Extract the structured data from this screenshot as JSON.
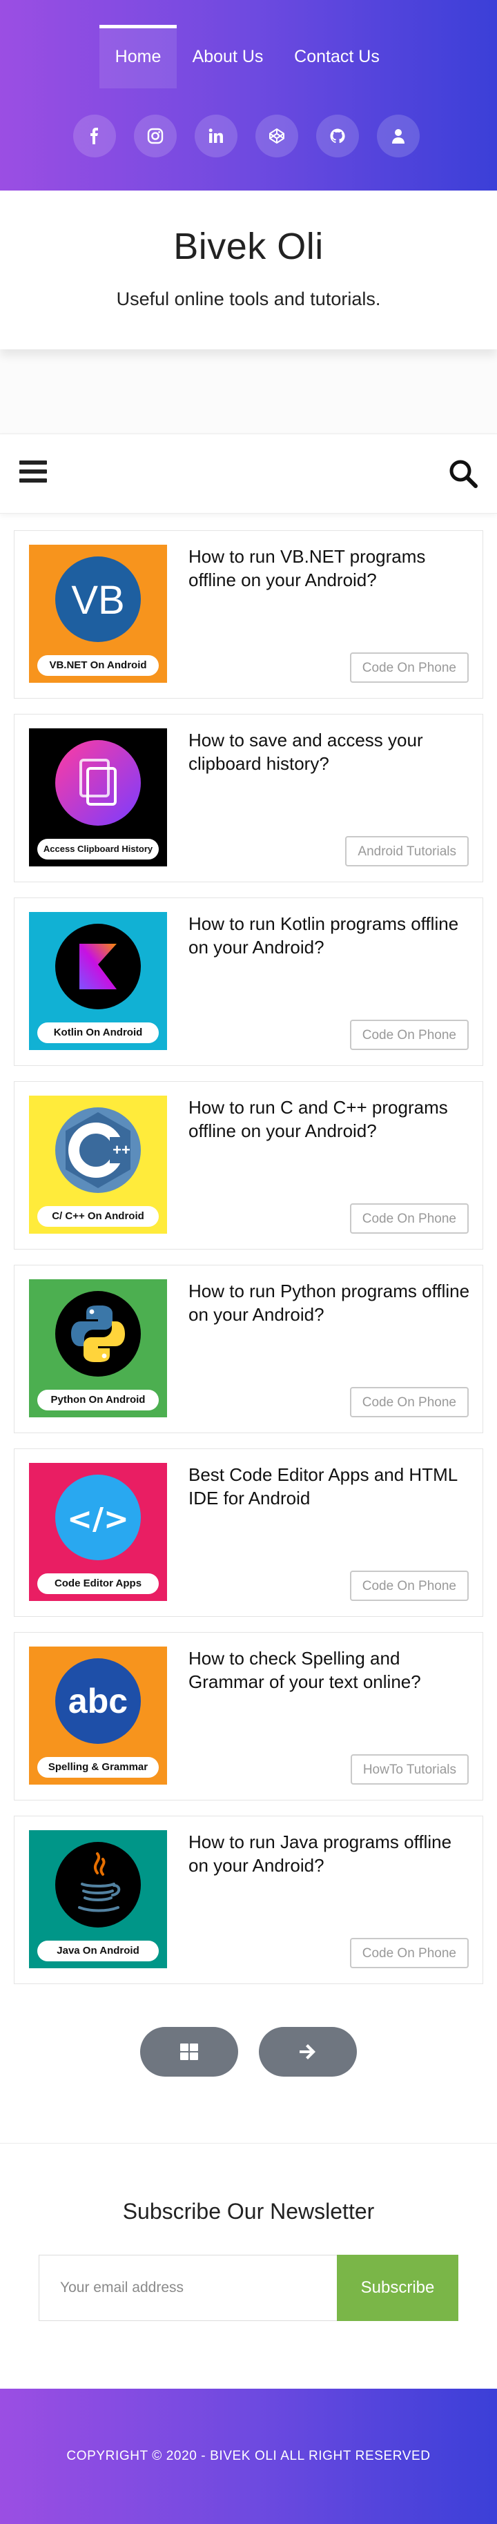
{
  "nav": {
    "items": [
      {
        "label": "Home",
        "active": true
      },
      {
        "label": "About Us",
        "active": false
      },
      {
        "label": "Contact Us",
        "active": false
      }
    ]
  },
  "social_icons": [
    "facebook-icon",
    "instagram-icon",
    "linkedin-icon",
    "codepen-icon",
    "github-icon",
    "user-icon"
  ],
  "site": {
    "title": "Bivek Oli",
    "description": "Useful online tools and tutorials."
  },
  "posts": [
    {
      "title": "How to run VB.NET programs offline on your Android?",
      "thumb_label": "VB.NET On Android",
      "thumb_text": "VB",
      "category": "Code On Phone",
      "thumb_bg": "#f7941d",
      "icon": "vbnet-logo-icon"
    },
    {
      "title": "How to save and access your clipboard history?",
      "thumb_label": "Access Clipboard History",
      "category": "Android Tutorials",
      "thumb_bg": "#000000",
      "icon": "clipboard-icon"
    },
    {
      "title": "How to run Kotlin programs offline on your Android?",
      "thumb_label": "Kotlin On Android",
      "category": "Code On Phone",
      "thumb_bg": "#11b1d4",
      "icon": "kotlin-logo-icon"
    },
    {
      "title": "How to run C and C++ programs offline on your Android?",
      "thumb_label": "C/ C++ On Android",
      "thumb_text": "C",
      "category": "Code On Phone",
      "thumb_bg": "#ffeb3b",
      "icon": "cpp-logo-icon"
    },
    {
      "title": "How to run Python programs offline on your Android?",
      "thumb_label": "Python On Android",
      "category": "Code On Phone",
      "thumb_bg": "#4caf50",
      "icon": "python-logo-icon"
    },
    {
      "title": "Best Code Editor Apps and HTML IDE for Android",
      "thumb_label": "Code Editor Apps",
      "thumb_text": "</>",
      "category": "Code On Phone",
      "thumb_bg": "#e91e63",
      "icon": "code-brackets-icon"
    },
    {
      "title": "How to check Spelling and Grammar of your text online?",
      "thumb_label": "Spelling & Grammar",
      "thumb_text": "abc",
      "category": "HowTo Tutorials",
      "thumb_bg": "#f7941d",
      "icon": "abc-icon"
    },
    {
      "title": "How to run Java programs offline on your Android?",
      "thumb_label": "Java On Android",
      "category": "Code On Phone",
      "thumb_bg": "#009688",
      "icon": "java-logo-icon"
    }
  ],
  "pagination": {
    "icons": [
      "grid-icon",
      "arrow-right-icon"
    ]
  },
  "newsletter": {
    "title": "Subscribe Our Newsletter",
    "placeholder": "Your email address",
    "button": "Subscribe"
  },
  "footer": {
    "copyright": "COPYRIGHT © 2020 - BIVEK OLI ALL RIGHT RESERVED"
  },
  "colors": {
    "gradient_start": "#9b4ee3",
    "gradient_end": "#3b3fd8",
    "subscribe_green": "#7ab648",
    "pager_gray": "#6f7680"
  }
}
